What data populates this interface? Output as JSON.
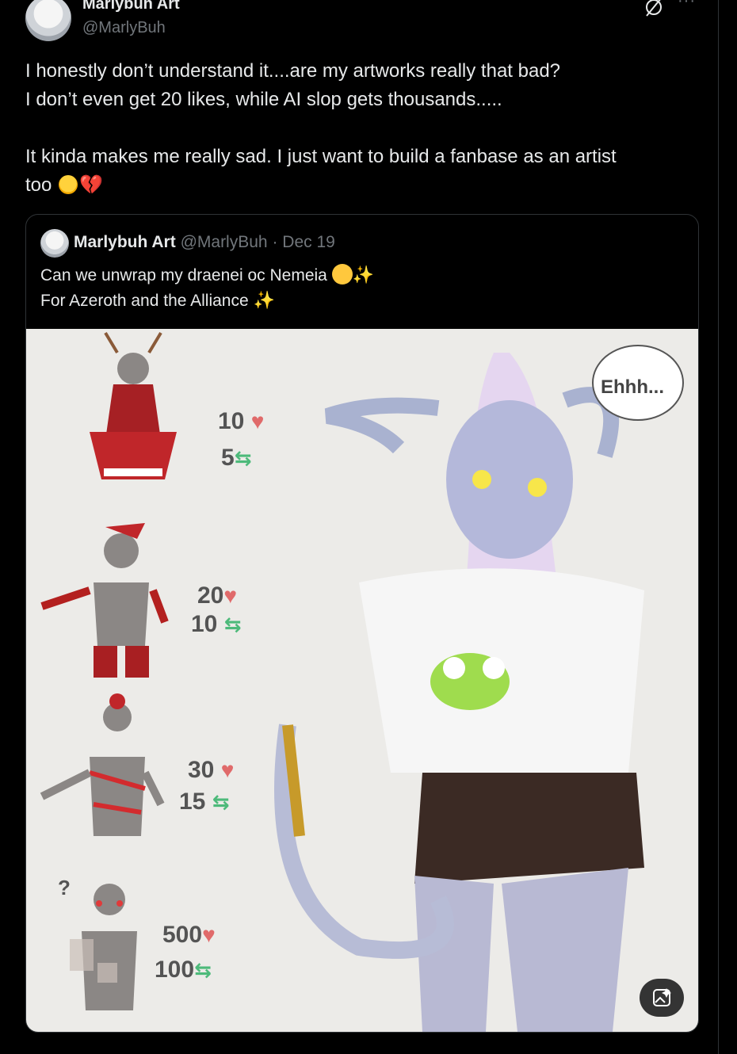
{
  "author": {
    "name": "Marlybuh Art",
    "handle": "@MarlyBuh"
  },
  "tweet": {
    "line1": "I honestly don’t understand it....are my artworks really that bad?",
    "line2": "I don’t even get 20 likes, while AI slop gets thousands.....",
    "line3": "It kinda makes me really sad. I just want to build a fanbase as an artist",
    "line4": "too"
  },
  "quote": {
    "name": "Marlybuh Art",
    "handle": "@MarlyBuh",
    "separator": "·",
    "date": "Dec 19",
    "line1": "Can we unwrap my draenei oc Nemeia",
    "line2": "For Azeroth and the Alliance"
  },
  "artwork": {
    "speech_bubble": "Ehhh...",
    "tiers": [
      {
        "likes": "10",
        "reposts": "5"
      },
      {
        "likes": "20",
        "reposts": "10"
      },
      {
        "likes": "30",
        "reposts": "15"
      },
      {
        "likes": "500",
        "reposts": "100"
      }
    ],
    "question_mark": "?"
  },
  "icons": {
    "grok": "grok-icon",
    "more": "more-icon",
    "heart": "heart-icon",
    "repost": "repost-icon",
    "alt_media": "image-sparkle-icon"
  },
  "colors": {
    "background": "#000000",
    "text": "#e7e9ea",
    "muted": "#71767b",
    "border": "#2f3336",
    "heart": "#e06a6a",
    "repost": "#4dba7a"
  }
}
